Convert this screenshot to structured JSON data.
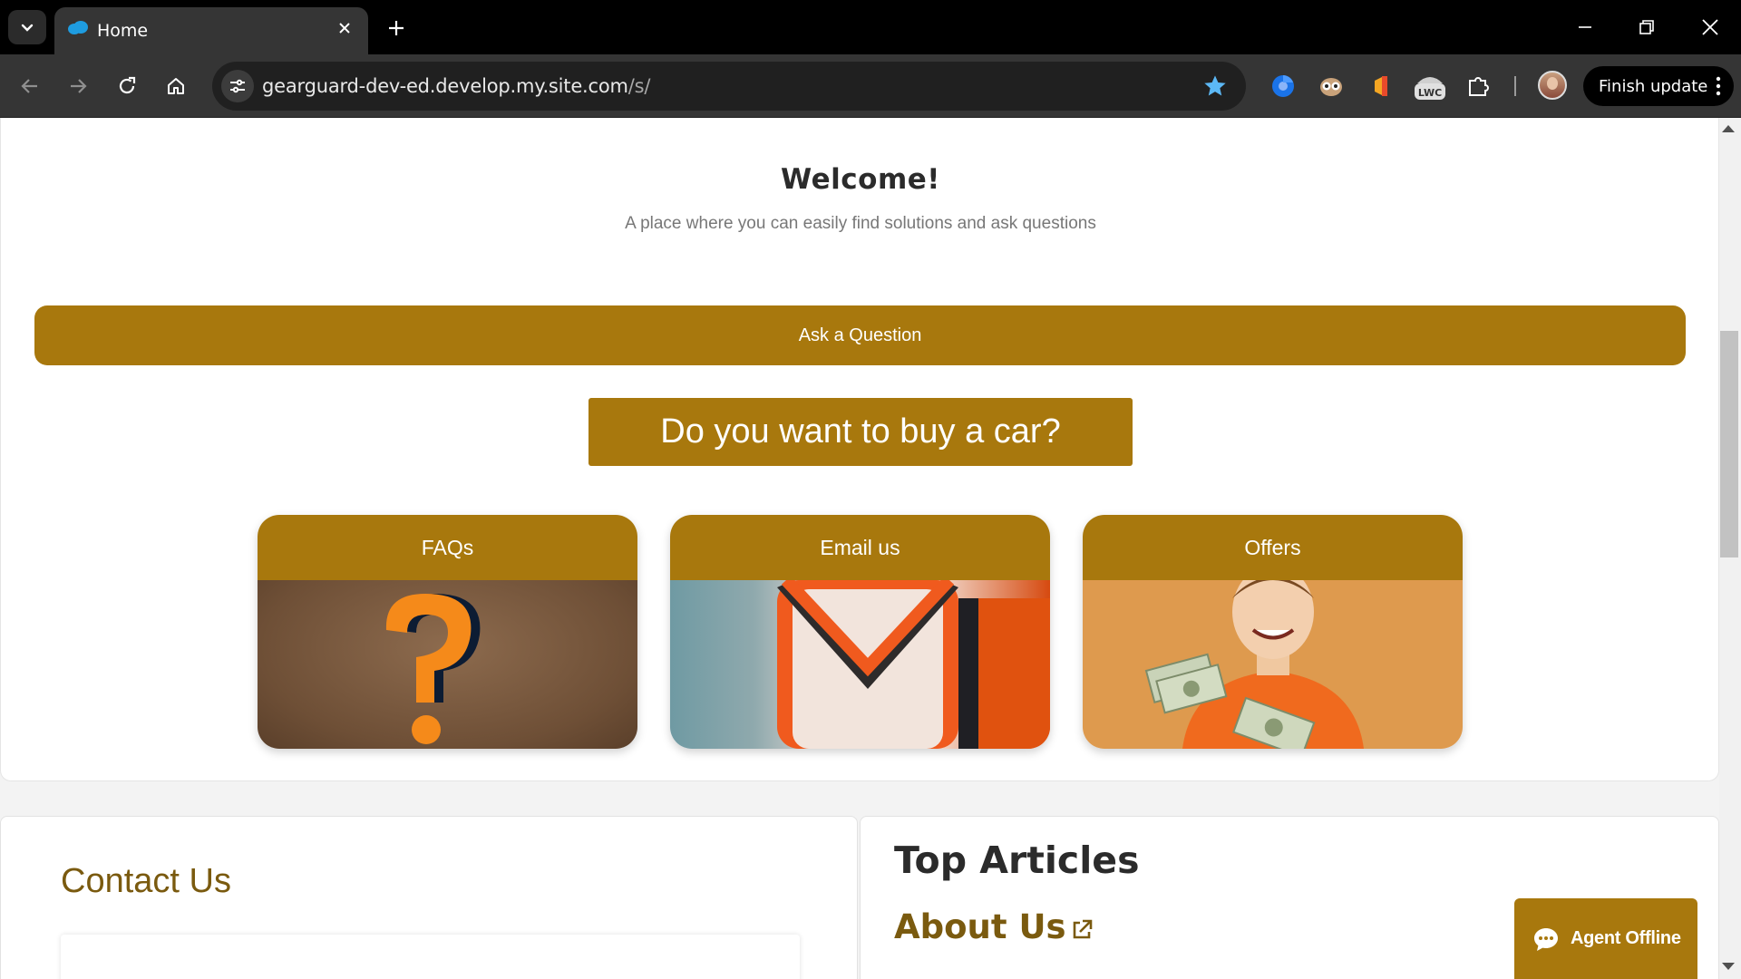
{
  "browser": {
    "tab_title": "Home",
    "url_host": "gearguard-dev-ed.develop.my.site.com",
    "url_path": "/s/",
    "finish_update_label": "Finish update",
    "extensions": [
      "chromium-icon",
      "owl-icon",
      "salesforce-flag-icon",
      "lwc-icon",
      "puzzle-icon"
    ],
    "lwc_label": "LWC"
  },
  "hero": {
    "welcome": "Welcome!",
    "subtitle": "A place where you can easily find solutions and ask questions",
    "ask_button": "Ask a Question",
    "buy_button": "Do you want to buy a car?"
  },
  "tiles": [
    {
      "label": "FAQs",
      "image": "question-mark-image"
    },
    {
      "label": "Email us",
      "image": "email-envelope-image"
    },
    {
      "label": "Offers",
      "image": "kid-with-money-image"
    }
  ],
  "contact": {
    "title": "Contact Us"
  },
  "articles": {
    "title": "Top Articles",
    "first_link": "About Us"
  },
  "chat": {
    "label": "Agent Offline"
  },
  "colors": {
    "accent": "#a8780d",
    "heading_gold": "#7a5a0f",
    "chrome_dark": "#353535"
  }
}
